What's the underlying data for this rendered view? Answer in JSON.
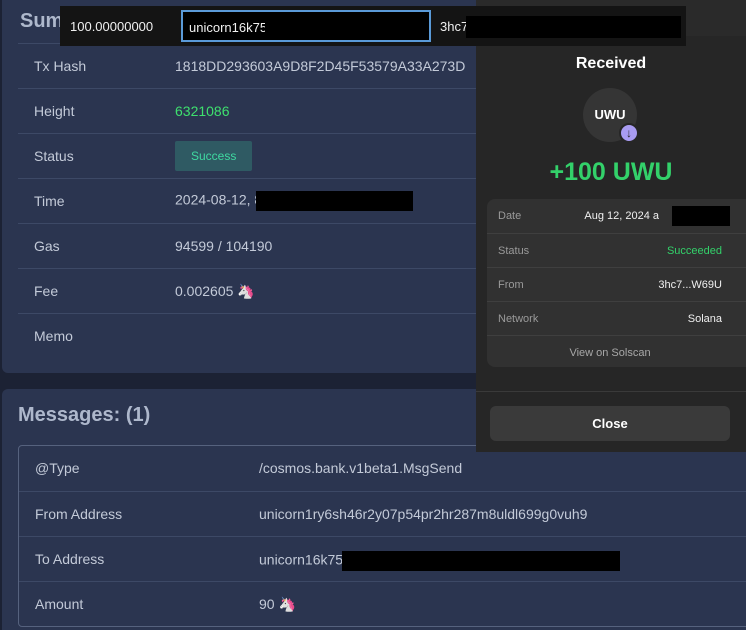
{
  "summary": {
    "title": "Sum",
    "rows": [
      {
        "key": "Tx Hash",
        "value": "1818DD293603A9D8F2D45F53579A33A273D"
      },
      {
        "key": "Height",
        "value": "6321086"
      },
      {
        "key": "Status",
        "value": "Success"
      },
      {
        "key": "Time",
        "value": "2024-08-12, 8"
      },
      {
        "key": "Gas",
        "value": "94599 / 104190"
      },
      {
        "key": "Fee",
        "value": "0.002605"
      },
      {
        "key": "Memo",
        "value": ""
      }
    ]
  },
  "messages": {
    "title": "Messages: (1)",
    "rows": [
      {
        "key": "@Type",
        "value": "/cosmos.bank.v1beta1.MsgSend"
      },
      {
        "key": "From Address",
        "value": "unicorn1ry6sh46r2y07p54pr2hr287m8uldl699g0vuh9"
      },
      {
        "key": "To Address",
        "value": "unicorn16k75"
      },
      {
        "key": "Amount",
        "value": "90"
      }
    ]
  },
  "icons": {
    "unicorn": "🦄",
    "receive_arrow": "↓"
  },
  "topbar": {
    "amount": "100.00000000",
    "recipient_value": "unicorn16k75",
    "sender_value": "3hc7l"
  },
  "wallet": {
    "title": "Received",
    "token_symbol": "UWU",
    "amount": "+100 UWU",
    "details": [
      {
        "key": "Date",
        "value": "Aug 12, 2024 a"
      },
      {
        "key": "Status",
        "value": "Succeeded"
      },
      {
        "key": "From",
        "value": "3hc7...W69U"
      },
      {
        "key": "Network",
        "value": "Solana"
      }
    ],
    "link_label": "View on Solscan",
    "close_label": "Close"
  },
  "colors": {
    "success_green": "#3ee06e",
    "wallet_green": "#33d16a",
    "accent_purple": "#a99cf2",
    "focus_blue": "#5a9ad8"
  }
}
